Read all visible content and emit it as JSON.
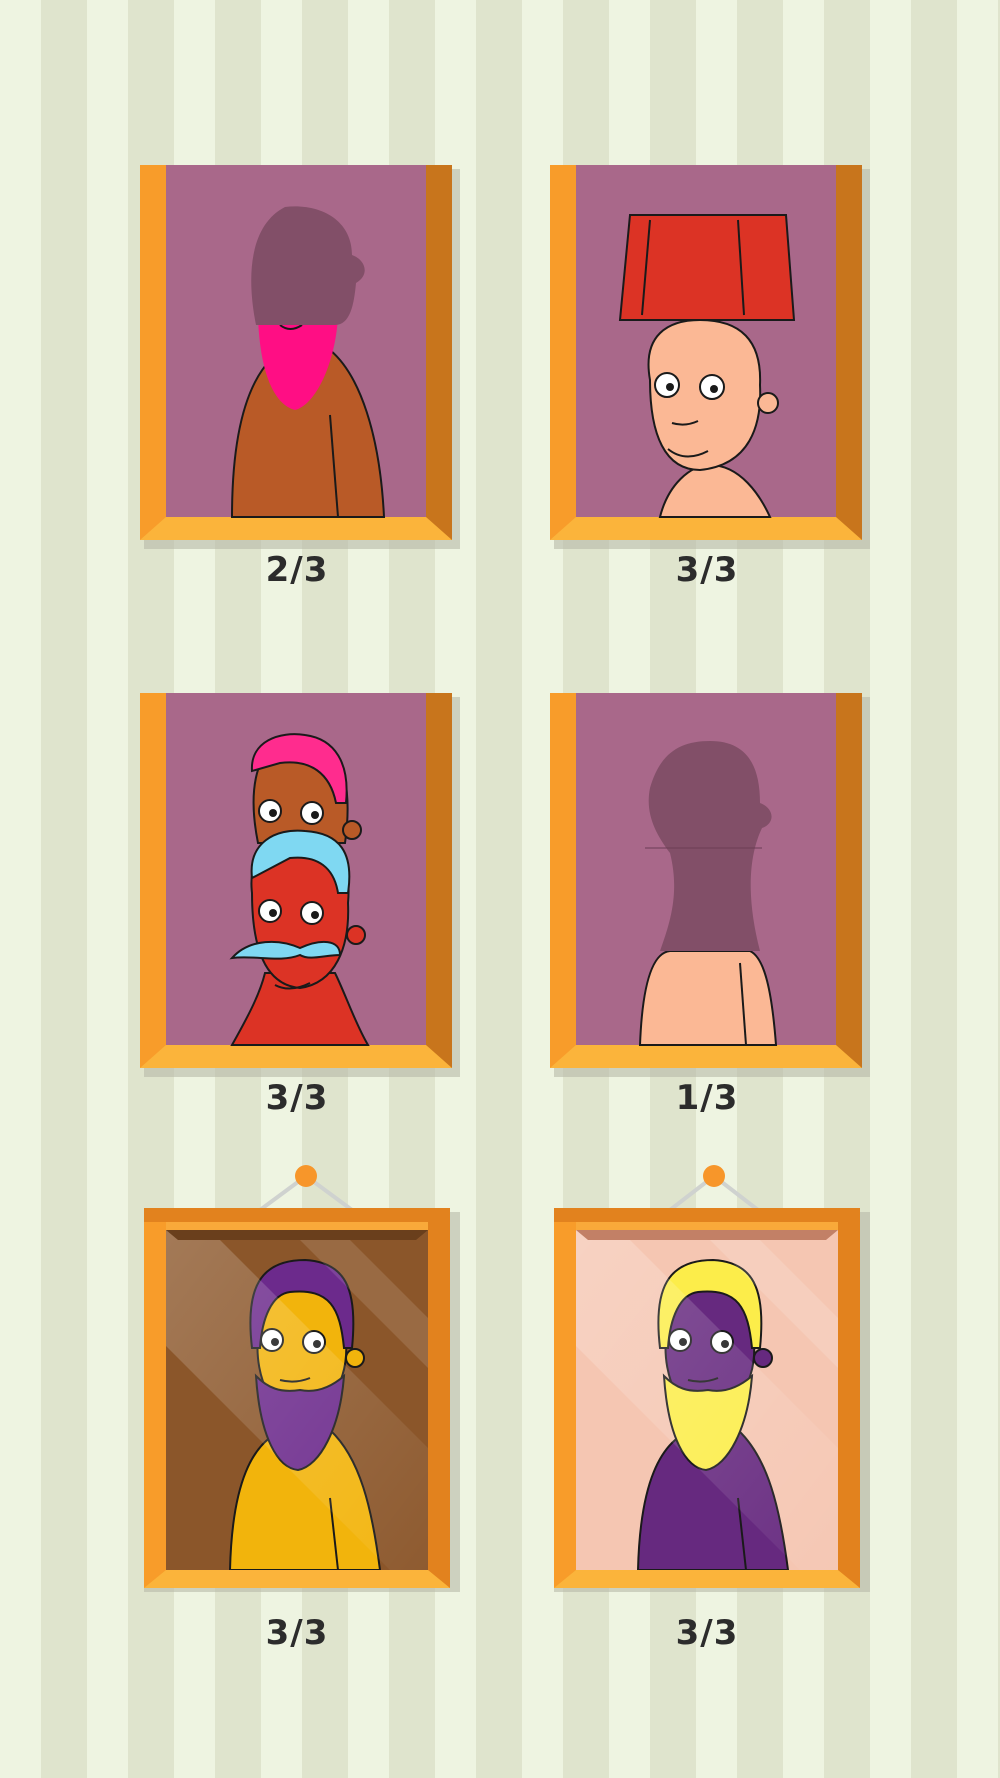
{
  "portraits": [
    {
      "id": "p1",
      "progress": "2/3",
      "state": "partial"
    },
    {
      "id": "p2",
      "progress": "3/3",
      "state": "complete"
    },
    {
      "id": "p3",
      "progress": "3/3",
      "state": "complete"
    },
    {
      "id": "p4",
      "progress": "1/3",
      "state": "partial"
    },
    {
      "id": "p5",
      "progress": "3/3",
      "state": "framed"
    },
    {
      "id": "p6",
      "progress": "3/3",
      "state": "framed"
    }
  ],
  "colors": {
    "wall_light": "#eef4e1",
    "wall_dark": "#dfe4cd",
    "frame_orange": "#f7962a",
    "frame_dark": "#c86d12",
    "canvas_purple": "#a9688a",
    "silhouette": "#824f68",
    "outline": "#1a1a1a"
  },
  "icons": [
    "picture-frame-icon",
    "portrait-icon",
    "hanger-pin-icon"
  ]
}
